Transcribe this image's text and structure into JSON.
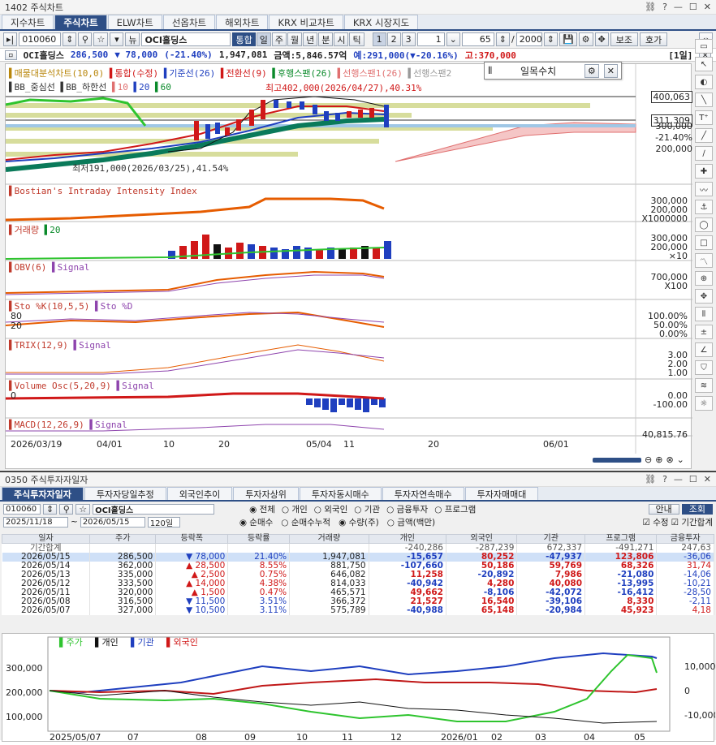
{
  "win1": {
    "title": "1402 주식차트",
    "tabs": [
      "지수차트",
      "주식차트",
      "ELW차트",
      "선옵차트",
      "해외차트",
      "KRX 비교차트",
      "KRX 시장지도"
    ],
    "code": "010060",
    "name": "OCI홀딩스",
    "views": [
      "통합",
      "일",
      "주",
      "월",
      "년",
      "분",
      "시",
      "틱"
    ],
    "pages": [
      "1",
      "2",
      "3"
    ],
    "interval": "1",
    "count": "65",
    "total": "2000",
    "btn_save": "보조",
    "btn_call": "호가",
    "info": {
      "name": "OCI홀딩스",
      "price": "286,500",
      "change": "▼ 78,000",
      "rate": "(-21.40%)",
      "volume": "1,947,081",
      "amount": "금액:5,846.57억",
      "ye": "예:291,000(▼-20.16%)",
      "go": "고:370,000",
      "period": "[1일]"
    },
    "legend1": [
      "매물대분석차트(10,0)",
      "통합(수정)",
      "기준선(26)",
      "전환선(9)",
      "후행스팬(26)",
      "선행스팬1(26)",
      "선행스팬2"
    ],
    "legend2": [
      "BB_중심선",
      "BB_하한선",
      "10",
      "20",
      "60"
    ],
    "max_label": "최고402,000(2026/04/27),40.31%",
    "min_label": "최저191,000(2026/03/25),41.54%",
    "price_axis": [
      "400,063",
      "311,309",
      "300,000",
      "-21.40%",
      "200,000"
    ],
    "popup_title": "일목수치",
    "panels": [
      {
        "label": "Bostian's Intraday Intensity Index",
        "axis": [
          "300,000",
          "200,000",
          "X1000000"
        ]
      },
      {
        "label": "거래량",
        "label2": "20",
        "axis": [
          "300,000",
          "200,000",
          "×10"
        ]
      },
      {
        "label": "OBV(6)",
        "label2": "Signal",
        "axis": [
          "700,000",
          "X100"
        ]
      },
      {
        "label": "Sto %K(10,5,5)",
        "label2": "Sto %D",
        "axis": [
          "100.00%",
          "50.00%",
          "0.00%"
        ],
        "marks": [
          "80",
          "20"
        ]
      },
      {
        "label": "TRIX(12,9)",
        "label2": "Signal",
        "axis": [
          "3.00",
          "2.00",
          "1.00"
        ]
      },
      {
        "label": "Volume Osc(5,20,9)",
        "label2": "Signal",
        "axis": [
          "0.00",
          "-100.00"
        ],
        "marks": [
          "0"
        ]
      },
      {
        "label": "MACD(12,26,9)",
        "label2": "Signal",
        "axis": [
          "40,815.76"
        ]
      }
    ],
    "date_axis": [
      "2026/03/19",
      "04/01",
      "10",
      "20",
      "05/04",
      "11",
      "20",
      "06/01"
    ]
  },
  "win2": {
    "title": "0350 주식투자자일자",
    "tabs": [
      "주식투자자일자",
      "투자자당일추정",
      "외국인추이",
      "투자자상위",
      "투자자동시매수",
      "투자자연속매수",
      "투자자매매대"
    ],
    "code": "010060",
    "name": "OCI홀딩스",
    "filters1": [
      "전체",
      "개인",
      "외국인",
      "기관",
      "금융투자",
      "프로그램"
    ],
    "btn_query_label": "안내",
    "btn_search": "조회",
    "date_from": "2025/11/18",
    "date_to": "2026/05/15",
    "range": "120일",
    "filters2": [
      "순매수",
      "순매수누적",
      "수량(주)",
      "금액(백만)"
    ],
    "chk_fix": "수정",
    "chk_sum": "기간합계",
    "headers": [
      "일자",
      "주가",
      "등락폭",
      "등락률",
      "거래량",
      "개인",
      "외국인",
      "기관",
      "프로그램",
      "금융투자"
    ],
    "sum_row": [
      "기간합계",
      "",
      "",
      "",
      "",
      "-240,286",
      "-287,239",
      "672,337",
      "-491,271",
      "247,63"
    ],
    "rows": [
      {
        "date": "2026/05/15",
        "price": "286,500",
        "dir": "▼",
        "chg": "78,000",
        "rate": "21.40%",
        "vol": "1,947,081",
        "ind": "-15,657",
        "frg": "80,252",
        "inst": "-47,937",
        "prog": "123,806",
        "fin": "-36,06"
      },
      {
        "date": "2026/05/14",
        "price": "362,000",
        "dir": "▲",
        "chg": "28,500",
        "rate": "8.55%",
        "vol": "881,750",
        "ind": "-107,660",
        "frg": "50,186",
        "inst": "59,769",
        "prog": "68,326",
        "fin": "31,74"
      },
      {
        "date": "2026/05/13",
        "price": "335,000",
        "dir": "▲",
        "chg": "2,500",
        "rate": "0.75%",
        "vol": "646,082",
        "ind": "11,258",
        "frg": "-20,892",
        "inst": "7,986",
        "prog": "-21,080",
        "fin": "-14,06"
      },
      {
        "date": "2026/05/12",
        "price": "333,500",
        "dir": "▲",
        "chg": "14,000",
        "rate": "4.38%",
        "vol": "814,033",
        "ind": "-40,942",
        "frg": "4,280",
        "inst": "40,080",
        "prog": "-13,995",
        "fin": "-10,21"
      },
      {
        "date": "2026/05/11",
        "price": "320,000",
        "dir": "▲",
        "chg": "1,500",
        "rate": "0.47%",
        "vol": "465,571",
        "ind": "49,662",
        "frg": "-8,106",
        "inst": "-42,072",
        "prog": "-16,412",
        "fin": "-28,50"
      },
      {
        "date": "2026/05/08",
        "price": "316,500",
        "dir": "▼",
        "chg": "11,500",
        "rate": "3.51%",
        "vol": "366,372",
        "ind": "21,527",
        "frg": "16,540",
        "inst": "-39,106",
        "prog": "8,330",
        "fin": "-2,11"
      },
      {
        "date": "2026/05/07",
        "price": "327,000",
        "dir": "▼",
        "chg": "10,500",
        "rate": "3.11%",
        "vol": "575,789",
        "ind": "-40,988",
        "frg": "65,148",
        "inst": "-20,984",
        "prog": "45,923",
        "fin": "4,18"
      }
    ],
    "chart_legend": [
      "주가",
      "개인",
      "기관",
      "외국인"
    ],
    "left_axis": [
      "300,000",
      "200,000",
      "100,000"
    ],
    "right_axis": [
      "10,000",
      "0",
      "-10,000"
    ],
    "bottom_axis": [
      "2025/05/07",
      "07",
      "08",
      "09",
      "10",
      "11",
      "12",
      "2026/01",
      "02",
      "03",
      "04",
      "05"
    ]
  },
  "colors": {
    "accent": "#2e4f86",
    "up": "#d01818",
    "down": "#1f3fbf"
  }
}
